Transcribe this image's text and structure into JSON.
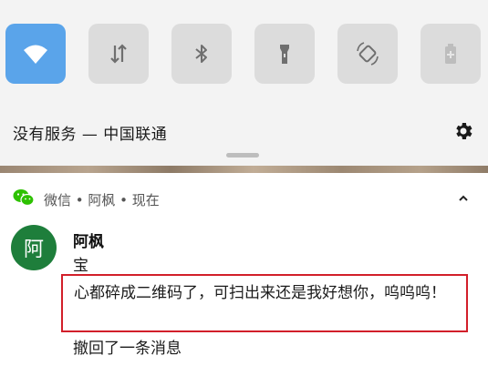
{
  "quick_settings": {
    "tiles": [
      {
        "name": "wifi",
        "icon": "wifi-icon",
        "state": "on"
      },
      {
        "name": "mobile-data",
        "icon": "data-arrows-icon",
        "state": "off"
      },
      {
        "name": "bluetooth",
        "icon": "bluetooth-icon",
        "state": "off"
      },
      {
        "name": "flashlight",
        "icon": "flashlight-icon",
        "state": "off"
      },
      {
        "name": "auto-rotate",
        "icon": "rotate-icon",
        "state": "off"
      },
      {
        "name": "battery-saver",
        "icon": "battery-icon",
        "state": "off"
      }
    ],
    "carrier_text": "没有服务 — 中国联通",
    "settings_icon": "gear-icon"
  },
  "notification": {
    "app_icon": "wechat-icon",
    "header": "微信 • 阿枫 • 现在",
    "expand_icon": "chevron-up-icon",
    "avatar_text": "阿",
    "sender": "阿枫",
    "messages": [
      "宝",
      "心都碎成二维码了，可扫出来还是我好想你，呜呜呜！",
      "撤回了一条消息"
    ]
  },
  "colors": {
    "accent": "#5aa4ea",
    "avatar": "#1e7e3b",
    "highlight_box": "#d21f2a",
    "wechat_green": "#2dc100"
  }
}
